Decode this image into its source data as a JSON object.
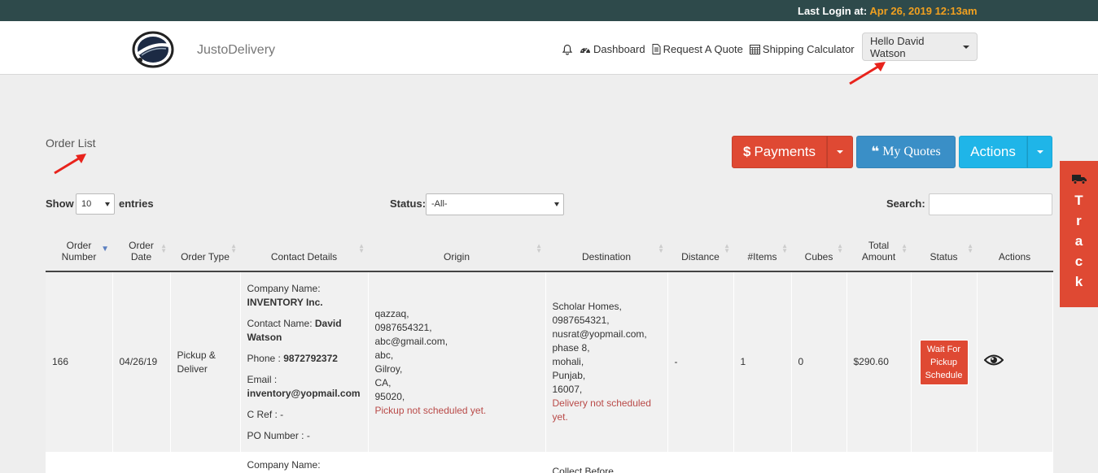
{
  "topbar": {
    "last_login_label": "Last Login at:",
    "last_login_time": "Apr 26, 2019 12:13am"
  },
  "brand": {
    "name": "JustoDelivery"
  },
  "nav": {
    "dashboard": "Dashboard",
    "request_quote": "Request A Quote",
    "shipping_calculator": "Shipping Calculator",
    "user_menu": "Hello David Watson"
  },
  "page": {
    "title": "Order List"
  },
  "buttons": {
    "payments": "Payments",
    "my_quotes": "My Quotes",
    "actions": "Actions"
  },
  "controls": {
    "show_label": "Show",
    "entries_value": "10",
    "entries_label": "entries",
    "status_label": "Status:",
    "status_value": "-All-",
    "search_label": "Search:"
  },
  "table": {
    "headers": [
      "Order Number",
      "Order Date",
      "Order Type",
      "Contact Details",
      "Origin",
      "Destination",
      "Distance",
      "#Items",
      "Cubes",
      "Total Amount",
      "Status",
      "Actions"
    ],
    "rows": [
      {
        "order_number": "166",
        "order_date": "04/26/19",
        "order_type": "Pickup & Deliver",
        "company_label": "Company Name:",
        "company": "INVENTORY Inc.",
        "contact_label": "Contact Name:",
        "contact": "David Watson",
        "phone_label": "Phone :",
        "phone": "9872792372",
        "email_label": "Email :",
        "email": "inventory@yopmail.com",
        "cref": "C Ref : -",
        "po": "PO Number : -",
        "origin": [
          "qazzaq,",
          "0987654321,",
          "abc@gmail.com,",
          "abc,",
          "Gilroy,",
          "CA,",
          "95020,"
        ],
        "origin_note": "Pickup not scheduled yet.",
        "destination": [
          "Scholar Homes,",
          "0987654321,",
          "nusrat@yopmail.com,",
          "phase 8,",
          "mohali,",
          "Punjab,",
          "16007,"
        ],
        "destination_note": "Delivery not scheduled yet.",
        "distance": "-",
        "items": "1",
        "cubes": "0",
        "total": "$290.60",
        "status": "Wait For Pickup Schedule"
      },
      {
        "company_label": "Company Name:",
        "destination_partial": "Collect Before"
      }
    ]
  },
  "track": {
    "label": "Track",
    "letters": [
      "T",
      "r",
      "a",
      "c",
      "k"
    ]
  },
  "colors": {
    "topbar": "#2e4a4b",
    "accent_red": "#df4933",
    "quotes_blue": "#3a8fc7",
    "actions_cyan": "#1fb5e8",
    "login_time": "#f0a020"
  },
  "icons": [
    "bell-icon",
    "dashboard-icon",
    "document-icon",
    "calculator-icon",
    "eye-icon",
    "truck-icon"
  ]
}
